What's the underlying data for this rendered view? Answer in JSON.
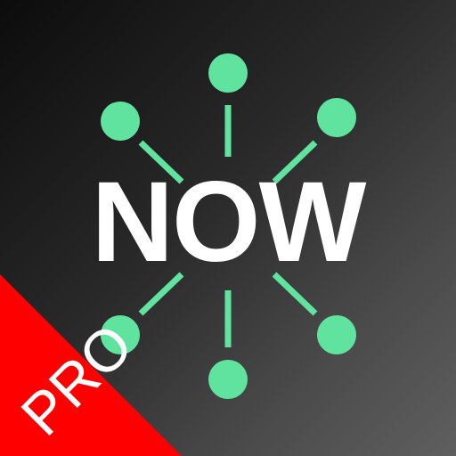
{
  "icon": {
    "wordmark": "NOW",
    "badge": "PRO"
  },
  "colors": {
    "accent": "#5fe39e",
    "ribbon": "#ff0000",
    "text": "#ffffff",
    "background_dark": "#0c0c0c",
    "background_light": "#5f5f5f"
  }
}
